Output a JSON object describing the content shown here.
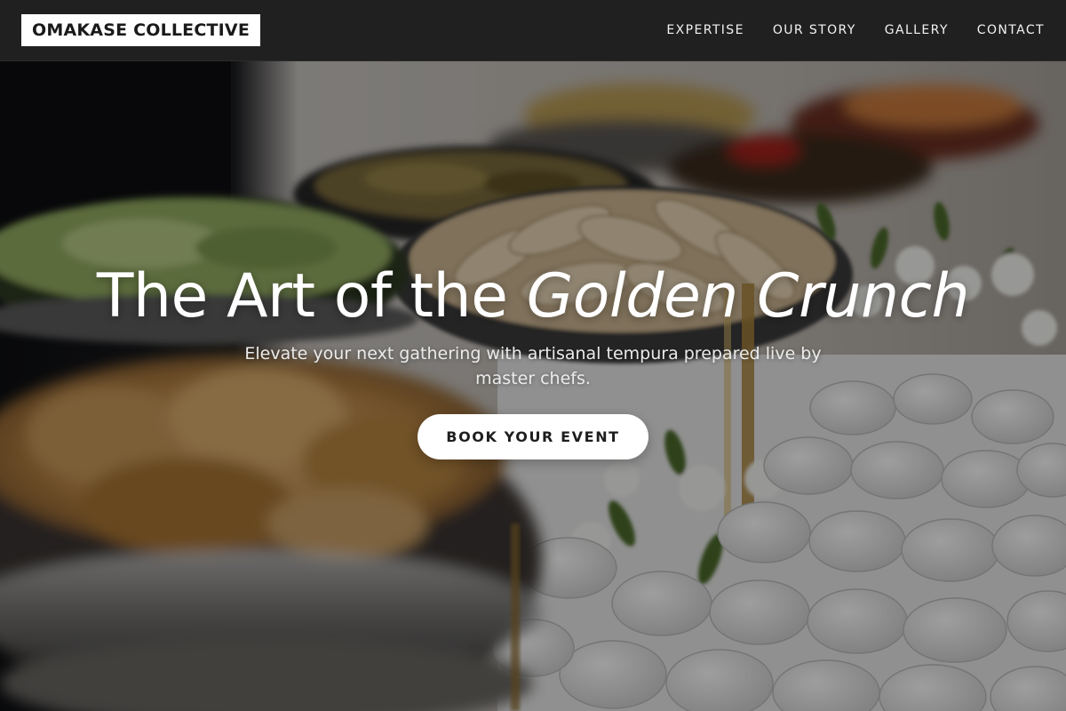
{
  "header": {
    "logo_text": "OMAKASE COLLECTIVE",
    "nav": [
      {
        "label": "EXPERTISE"
      },
      {
        "label": "OUR STORY"
      },
      {
        "label": "GALLERY"
      },
      {
        "label": "CONTACT"
      }
    ]
  },
  "hero": {
    "title_plain": "The Art of the ",
    "title_emphasis": "Golden Crunch",
    "subtitle": "Elevate your next gathering with artisanal tempura prepared live by master chefs.",
    "cta_label": "BOOK YOUR EVENT",
    "background_image": "catering buffet with chafing dishes of food and white flowers on white stones"
  },
  "colors": {
    "header_bg": "#202020",
    "logo_bg": "#ffffff",
    "logo_text": "#1a1a1a",
    "nav_text": "#f2f2f2",
    "hero_text": "#ffffff",
    "cta_bg": "#ffffff",
    "cta_text": "#1e1e1e"
  }
}
